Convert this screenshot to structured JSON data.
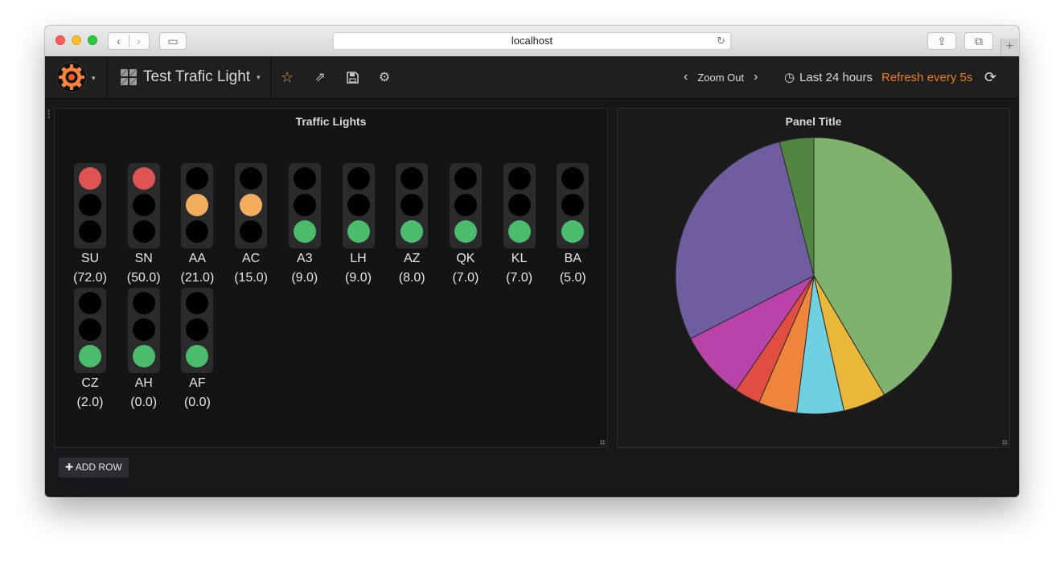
{
  "browser": {
    "url": "localhost",
    "back_glyph": "‹",
    "forward_glyph": "›",
    "sidebar_glyph": "▭",
    "reload_glyph": "↻",
    "share_glyph": "⇪",
    "tabs_glyph": "⧉",
    "new_tab_glyph": "+"
  },
  "navbar": {
    "dashboard_title": "Test Trafic Light",
    "zoom_out": "Zoom Out",
    "time_range": "Last 24 hours",
    "refresh_label": "Refresh every 5s",
    "icons": [
      "dashboard-grid-icon",
      "star-icon",
      "share-icon",
      "save-icon",
      "gear-icon",
      "clock-icon",
      "refresh-icon"
    ],
    "glyphs": {
      "star": "☆",
      "share": "⇗",
      "save": "💾",
      "gear": "⚙",
      "chev_left": "‹",
      "chev_right": "›",
      "clock": "◷",
      "refresh": "⟳",
      "caret": "▾"
    }
  },
  "traffic_panel": {
    "title": "Traffic Lights",
    "lights": [
      {
        "name": "SU",
        "value": "(72.0)",
        "state": "red"
      },
      {
        "name": "SN",
        "value": "(50.0)",
        "state": "red"
      },
      {
        "name": "AA",
        "value": "(21.0)",
        "state": "orange"
      },
      {
        "name": "AC",
        "value": "(15.0)",
        "state": "orange"
      },
      {
        "name": "A3",
        "value": "(9.0)",
        "state": "green"
      },
      {
        "name": "LH",
        "value": "(9.0)",
        "state": "green"
      },
      {
        "name": "AZ",
        "value": "(8.0)",
        "state": "green"
      },
      {
        "name": "QK",
        "value": "(7.0)",
        "state": "green"
      },
      {
        "name": "KL",
        "value": "(7.0)",
        "state": "green"
      },
      {
        "name": "BA",
        "value": "(5.0)",
        "state": "green"
      },
      {
        "name": "CZ",
        "value": "(2.0)",
        "state": "green"
      },
      {
        "name": "AH",
        "value": "(0.0)",
        "state": "green"
      },
      {
        "name": "AF",
        "value": "(0.0)",
        "state": "green"
      }
    ]
  },
  "pie_panel": {
    "title": "Panel Title"
  },
  "add_row": {
    "label": "✚ ADD ROW"
  },
  "colors": {
    "red": "#e05353",
    "orange": "#f2ad5d",
    "green": "#4bbc6b",
    "accent": "#eb7b18"
  },
  "chart_data": {
    "type": "pie",
    "title": "Panel Title",
    "slices": [
      {
        "value": 41.5,
        "color": "#7eb26d"
      },
      {
        "value": 5.0,
        "color": "#eab839"
      },
      {
        "value": 5.5,
        "color": "#6ed0e0"
      },
      {
        "value": 4.5,
        "color": "#ef843c"
      },
      {
        "value": 3.0,
        "color": "#e24d42"
      },
      {
        "value": 8.0,
        "color": "#ba43a9"
      },
      {
        "value": 28.5,
        "color": "#705da0"
      },
      {
        "value": 4.0,
        "color": "#508642"
      }
    ]
  }
}
